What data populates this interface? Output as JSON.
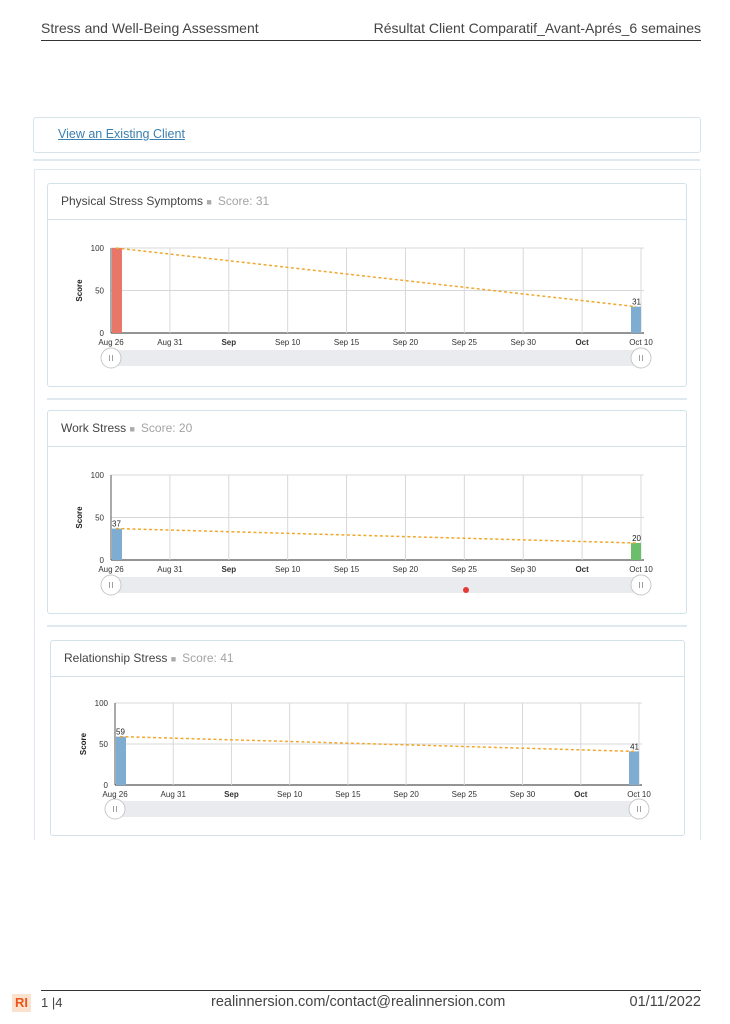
{
  "header": {
    "left_title": "Stress and Well-Being Assessment",
    "right_title": "Résultat Client Comparatif_Avant-Aprés_6 semaines"
  },
  "client_link": "View an Existing Client",
  "colors": {
    "red_bar": "#e8776a",
    "blue_bar": "#7fadd1",
    "green_bar": "#6bbf6b",
    "trend": "#f0a830"
  },
  "charts": [
    {
      "title": "Physical Stress Symptoms",
      "score_text": "Score: 31"
    },
    {
      "title": "Work Stress",
      "score_text": "Score: 20"
    },
    {
      "title": "Relationship Stress",
      "score_text": "Score: 41"
    }
  ],
  "chart_data": [
    {
      "type": "bar",
      "title": "Physical Stress Symptoms",
      "ylabel": "Score",
      "ylim": [
        0,
        100
      ],
      "yticks": [
        0,
        50,
        100
      ],
      "xticks": [
        "Aug 26",
        "Aug 31",
        "Sep",
        "Sep 10",
        "Sep 15",
        "Sep 20",
        "Sep 25",
        "Sep 30",
        "Oct",
        "Oct 10"
      ],
      "xticks_bold": [
        "Sep",
        "Oct"
      ],
      "x": [
        "Aug 26",
        "Oct 10"
      ],
      "values": [
        100,
        31
      ],
      "bar_colors": [
        "#e8776a",
        "#7fadd1"
      ],
      "data_labels": [
        "",
        "31"
      ],
      "trend": [
        100,
        31
      ],
      "grid": true
    },
    {
      "type": "bar",
      "title": "Work Stress",
      "ylabel": "Score",
      "ylim": [
        0,
        100
      ],
      "yticks": [
        0,
        50,
        100
      ],
      "xticks": [
        "Aug 26",
        "Aug 31",
        "Sep",
        "Sep 10",
        "Sep 15",
        "Sep 20",
        "Sep 25",
        "Sep 30",
        "Oct",
        "Oct 10"
      ],
      "xticks_bold": [
        "Sep",
        "Oct"
      ],
      "x": [
        "Aug 26",
        "Oct 10"
      ],
      "values": [
        37,
        20
      ],
      "bar_colors": [
        "#7fadd1",
        "#6bbf6b"
      ],
      "data_labels": [
        "37",
        "20"
      ],
      "trend": [
        37,
        20
      ],
      "grid": true
    },
    {
      "type": "bar",
      "title": "Relationship Stress",
      "ylabel": "Score",
      "ylim": [
        0,
        100
      ],
      "yticks": [
        0,
        50,
        100
      ],
      "xticks": [
        "Aug 26",
        "Aug 31",
        "Sep",
        "Sep 10",
        "Sep 15",
        "Sep 20",
        "Sep 25",
        "Sep 30",
        "Oct",
        "Oct 10"
      ],
      "xticks_bold": [
        "Sep",
        "Oct"
      ],
      "x": [
        "Aug 26",
        "Oct 10"
      ],
      "values": [
        59,
        41
      ],
      "bar_colors": [
        "#7fadd1",
        "#7fadd1"
      ],
      "data_labels": [
        "59",
        "41"
      ],
      "trend": [
        59,
        41
      ],
      "grid": true
    }
  ],
  "footer": {
    "logo": "RI",
    "page": "1 |4",
    "center": "realinnersion.com/contact@realinnersion.com",
    "date": "01/11/2022"
  }
}
